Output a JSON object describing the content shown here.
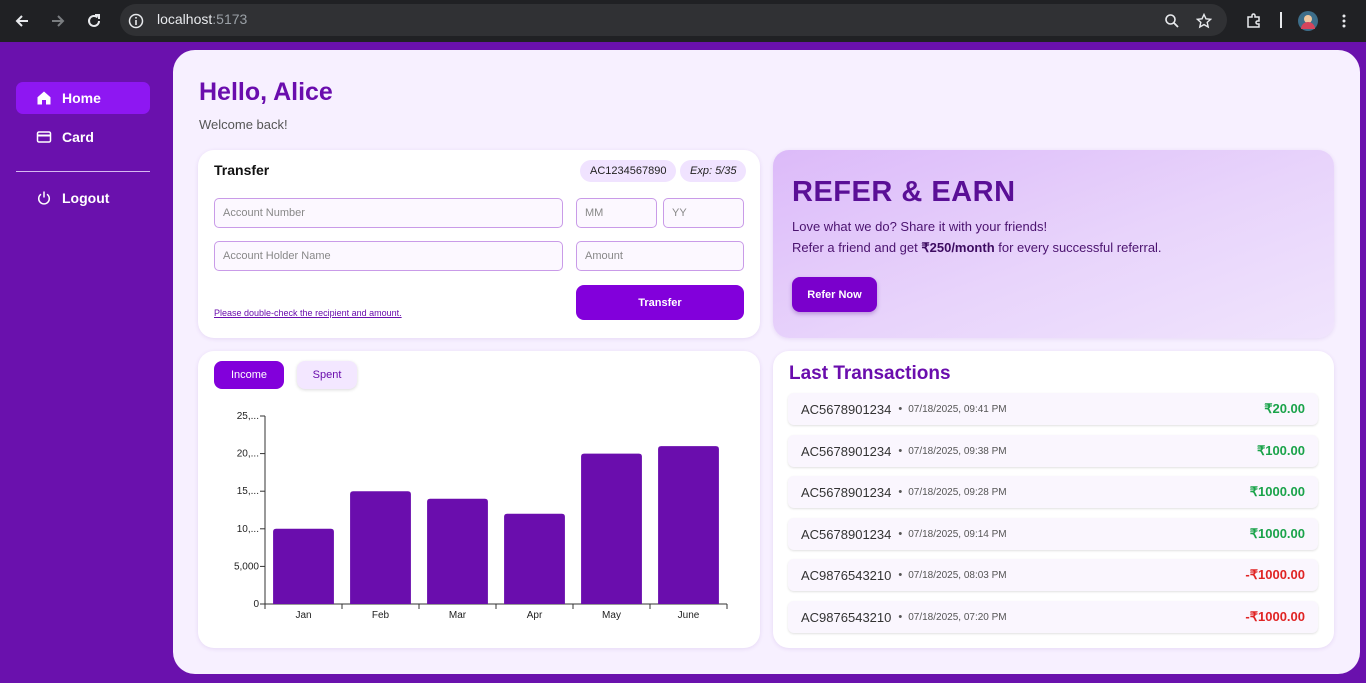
{
  "browser": {
    "url_host": "localhost",
    "url_port": ":5173"
  },
  "sidebar": {
    "items": [
      {
        "label": "Home",
        "icon": "home-icon",
        "active": true
      },
      {
        "label": "Card",
        "icon": "card-icon",
        "active": false
      }
    ],
    "logout_label": "Logout"
  },
  "header": {
    "greeting": "Hello, Alice",
    "subtitle": "Welcome back!"
  },
  "transfer": {
    "title": "Transfer",
    "account_badge": "AC1234567890",
    "expiry_badge": "Exp: 5/35",
    "account_number_placeholder": "Account Number",
    "mm_placeholder": "MM",
    "yy_placeholder": "YY",
    "holder_name_placeholder": "Account Holder Name",
    "amount_placeholder": "Amount",
    "note": "Please double-check the recipient and amount.",
    "button_label": "Transfer"
  },
  "refer": {
    "title": "REFER & EARN",
    "line1": "Love what we do? Share it with your friends!",
    "line2_prefix": "Refer a friend and get ",
    "line2_bold": "₹250/month",
    "line2_suffix": " for every successful referral.",
    "button_label": "Refer Now"
  },
  "chart_tabs": {
    "income_label": "Income",
    "spent_label": "Spent",
    "active": "Income"
  },
  "chart_data": {
    "type": "bar",
    "categories": [
      "Jan",
      "Feb",
      "Mar",
      "Apr",
      "May",
      "June"
    ],
    "values": [
      10000,
      15000,
      14000,
      12000,
      20000,
      21000
    ],
    "ytick_labels": [
      "0",
      "5,000",
      "10,...",
      "15,...",
      "20,...",
      "25,..."
    ],
    "ylim": [
      0,
      25000
    ],
    "bar_color": "#6a0dad",
    "title": "",
    "xlabel": "",
    "ylabel": ""
  },
  "transactions": {
    "title": "Last Transactions",
    "rows": [
      {
        "account": "AC5678901234",
        "time": "07/18/2025, 09:41 PM",
        "amount": "₹20.00",
        "type": "credit"
      },
      {
        "account": "AC5678901234",
        "time": "07/18/2025, 09:38 PM",
        "amount": "₹100.00",
        "type": "credit"
      },
      {
        "account": "AC5678901234",
        "time": "07/18/2025, 09:28 PM",
        "amount": "₹1000.00",
        "type": "credit"
      },
      {
        "account": "AC5678901234",
        "time": "07/18/2025, 09:14 PM",
        "amount": "₹1000.00",
        "type": "credit"
      },
      {
        "account": "AC9876543210",
        "time": "07/18/2025, 08:03 PM",
        "amount": "-₹1000.00",
        "type": "debit"
      },
      {
        "account": "AC9876543210",
        "time": "07/18/2025, 07:20 PM",
        "amount": "-₹1000.00",
        "type": "debit"
      }
    ]
  },
  "colors": {
    "brand_purple": "#6a0dad",
    "button_purple": "#8200db",
    "credit_green": "#1aa34a",
    "debit_red": "#e02424"
  }
}
